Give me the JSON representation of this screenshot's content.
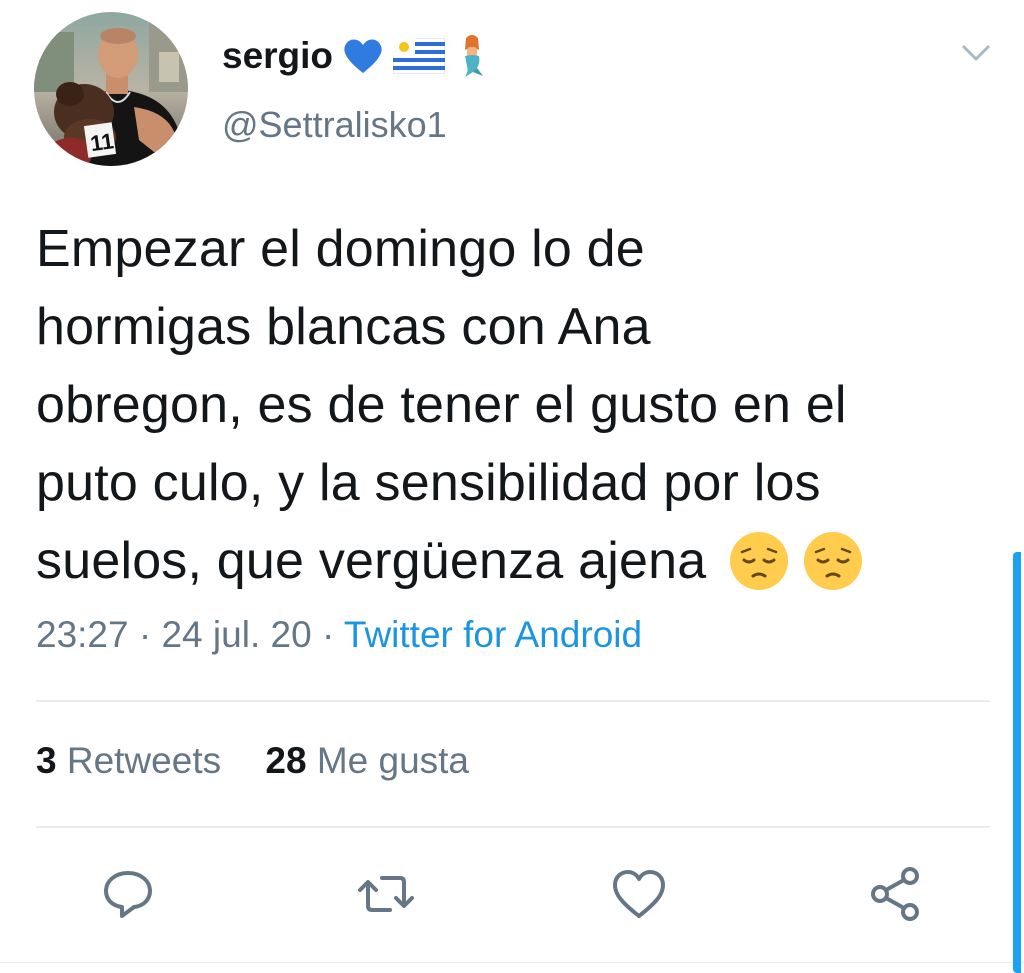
{
  "author": {
    "display_name": "sergio",
    "name_emojis": [
      "blue-heart",
      "uruguay-flag",
      "mermaid"
    ],
    "handle": "@Settralisko1",
    "avatar_badge_number": "11"
  },
  "tweet": {
    "lines": [
      "Empezar el domingo lo de",
      "hormigas blancas con Ana",
      "obregon, es de tener el gusto en el",
      "puto culo, y la sensibilidad por los",
      "suelos, que vergüenza ajena"
    ],
    "trailing_emojis": [
      "pensive-face",
      "pensive-face"
    ]
  },
  "meta": {
    "time": "23:27",
    "date": "24 jul. 20",
    "separator": "·",
    "source": "Twitter for Android"
  },
  "stats": {
    "retweets_count": "3",
    "retweets_label": "Retweets",
    "likes_count": "28",
    "likes_label": "Me gusta"
  },
  "actions": [
    "reply-icon",
    "retweet-icon",
    "like-icon",
    "share-icon"
  ],
  "colors": {
    "text_primary": "#14171a",
    "text_secondary": "#657786",
    "link": "#1b95e0",
    "divider": "#e6ecf0",
    "accent": "#1da1f2"
  }
}
